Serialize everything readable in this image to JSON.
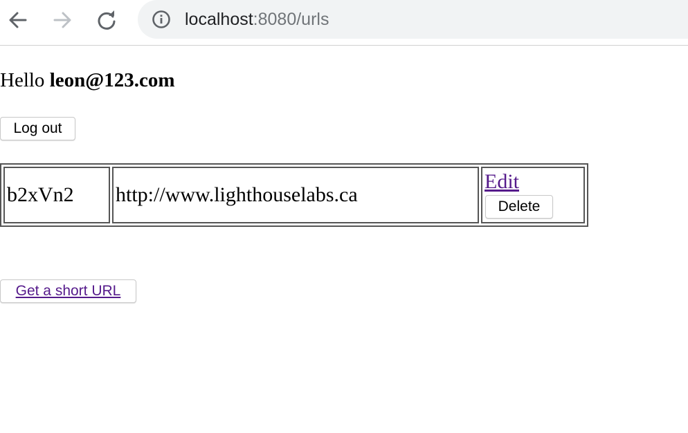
{
  "browser": {
    "nav": {
      "back_icon": "arrow-left-icon",
      "forward_icon": "arrow-right-icon",
      "reload_icon": "reload-icon"
    },
    "address_bar": {
      "info_icon": "info-circle-icon",
      "host": "localhost",
      "port_and_path": ":8080/urls"
    }
  },
  "page": {
    "greeting_prefix": "Hello ",
    "user_email": "leon@123.com",
    "logout_label": "Log out",
    "urls": [
      {
        "short_id": "b2xVn2",
        "long_url": "http://www.lighthouselabs.ca",
        "edit_label": "Edit",
        "delete_label": "Delete"
      }
    ],
    "create_link_label": "Get a short URL"
  },
  "colors": {
    "link": "#551a8b",
    "omnibox_bg": "#f1f3f4",
    "table_border": "#555555"
  }
}
